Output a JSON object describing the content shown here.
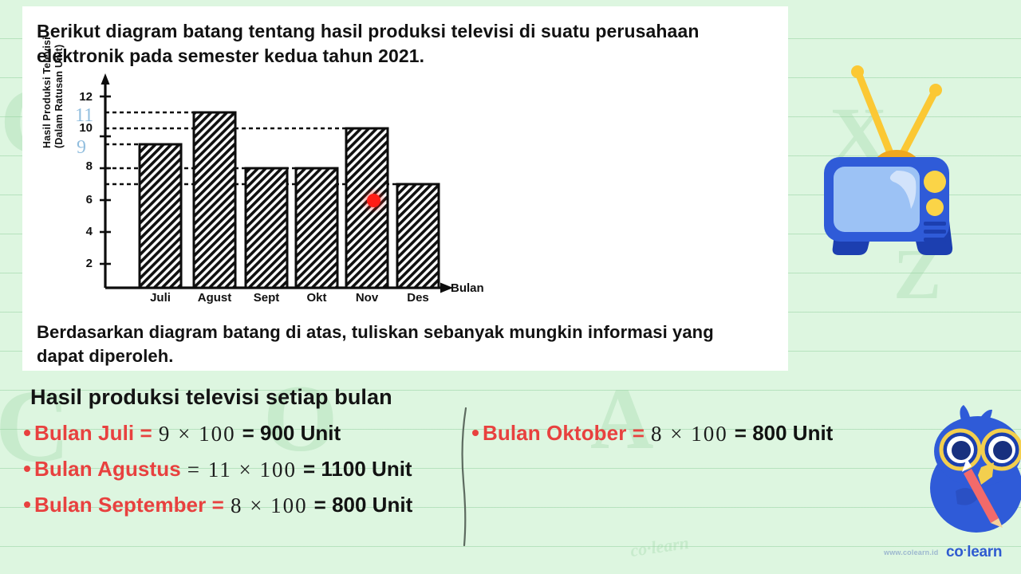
{
  "question": {
    "intro_line1": "Berikut diagram batang tentang hasil produksi televisi di suatu perusahaan",
    "intro_line2": "elektronik pada semester kedua tahun 2021.",
    "outro_line1": "Berdasarkan diagram batang di atas, tuliskan sebanyak mungkin informasi yang",
    "outro_line2": "dapat diperoleh."
  },
  "chart_data": {
    "type": "bar",
    "title": "",
    "categories": [
      "Juli",
      "Agust",
      "Sept",
      "Okt",
      "Nov",
      "Des"
    ],
    "values": [
      9,
      11,
      8,
      8,
      10,
      7
    ],
    "xlabel": "Bulan",
    "ylabel_line1": "Hasil Produksi Televisi",
    "ylabel_line2": "(Dalam Ratusan Unit)",
    "ylim": [
      0,
      13
    ],
    "yticks": [
      2,
      4,
      6,
      8,
      10,
      12
    ],
    "grid": "dashed-guide-lines-at-bar-tops",
    "legend": "none",
    "annotations": [
      {
        "text": "11",
        "note": "handwritten blue mark near y=11"
      },
      {
        "text": "9",
        "note": "handwritten blue mark near y=9"
      }
    ],
    "cursor": {
      "type": "red-dot",
      "at_category": "Nov",
      "at_value": 10
    }
  },
  "answer": {
    "title": "Hasil produksi televisi setiap bulan",
    "rows_left": [
      {
        "label": "Bulan Juli =",
        "handwritten": "9 × 100",
        "result": "= 900 Unit"
      },
      {
        "label": "Bulan Agustus",
        "handwritten": "= 11 × 100",
        "result": "= 1100 Unit"
      },
      {
        "label": "Bulan September =",
        "handwritten": "8 × 100",
        "result": "= 800 Unit"
      }
    ],
    "rows_right": [
      {
        "label": "Bulan Oktober =",
        "handwritten": "8 × 100",
        "result": "= 800 Unit"
      }
    ]
  },
  "footer": {
    "url": "www.colearn.id",
    "logo_part1": "co",
    "logo_dot": "·",
    "logo_part2": "learn"
  },
  "colors": {
    "page_bg": "#ddf6e0",
    "rule_line": "#78c387",
    "card_bg": "#ffffff",
    "answer_red": "#e8413f",
    "ink_black": "#121212",
    "tv_body": "#2f5bd8",
    "tv_screen": "#9cc2f5",
    "tv_antenna": "#fbc834",
    "mascot_blue": "#2f5bd8",
    "logo_blue": "#2f5bd0",
    "cursor_red": "#ff1d16",
    "hand_blue": "#7fb3d9"
  },
  "decor": {
    "tv_icon": "television-icon",
    "mascot_icon": "owl-mascot-icon",
    "cursor_icon": "red-cursor-dot-icon"
  }
}
